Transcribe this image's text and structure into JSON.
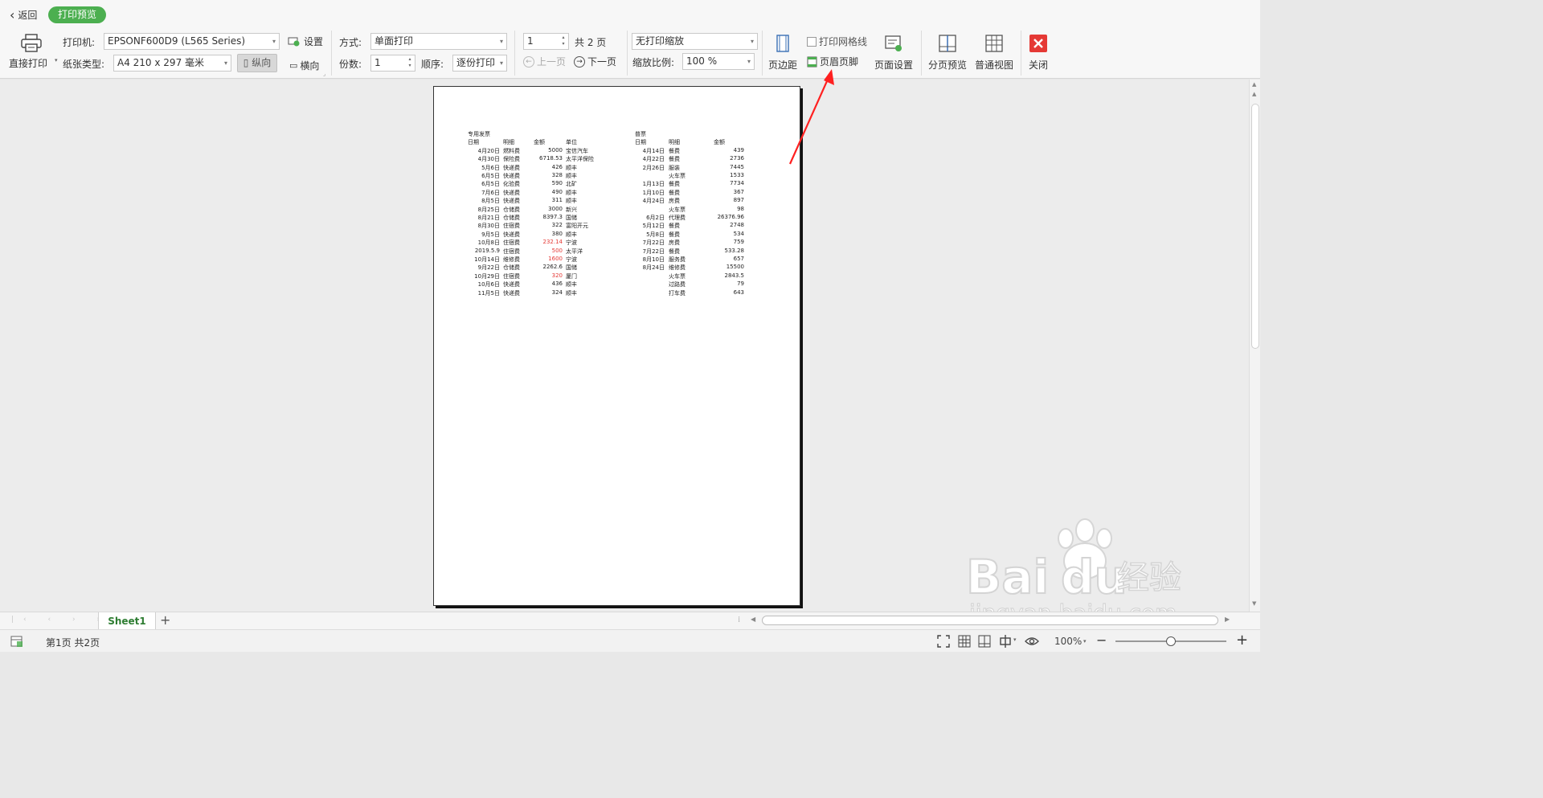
{
  "header": {
    "back_label": "返回",
    "mode_label": "打印预览"
  },
  "toolbar": {
    "direct_print": "直接打印",
    "printer_label": "打印机:",
    "printer_value": "EPSONF600D9 (L565 Series)",
    "settings_label": "设置",
    "paper_label": "纸张类型:",
    "paper_value": "A4 210 x 297 毫米",
    "portrait_label": "纵向",
    "landscape_label": "横向",
    "method_label": "方式:",
    "method_value": "单面打印",
    "copies_label": "份数:",
    "copies_value": "1",
    "order_label": "顺序:",
    "order_value": "逐份打印",
    "page_value": "1",
    "page_total": "共 2 页",
    "prev_page": "上一页",
    "next_page": "下一页",
    "scale_mode_value": "无打印缩放",
    "scale_label": "缩放比例:",
    "scale_value": "100 %",
    "margins_label": "页边距",
    "gridlines_label": "打印网格线",
    "header_footer_label": "页眉页脚",
    "page_setup_label": "页面设置",
    "page_break_preview_label": "分页预览",
    "normal_view_label": "普通视图",
    "close_label": "关闭"
  },
  "sheet": {
    "left_title": "专用发票",
    "left_headers": [
      "日期",
      "明细",
      "金额",
      "单位"
    ],
    "left_rows": [
      [
        "4月20日",
        "燃料费",
        "5000",
        "宝信汽车"
      ],
      [
        "4月30日",
        "保险费",
        "6718.53",
        "太平洋保险"
      ],
      [
        "5月6日",
        "快递费",
        "426",
        "顺丰"
      ],
      [
        "6月5日",
        "快递费",
        "328",
        "顺丰"
      ],
      [
        "6月5日",
        "化验费",
        "590",
        "北矿"
      ],
      [
        "7月6日",
        "快递费",
        "490",
        "顺丰"
      ],
      [
        "8月5日",
        "快递费",
        "311",
        "顺丰"
      ],
      [
        "8月25日",
        "仓储费",
        "3000",
        "新兴"
      ],
      [
        "8月21日",
        "仓储费",
        "8397.3",
        "国储"
      ],
      [
        "8月30日",
        "住宿费",
        "322",
        "富阳开元"
      ],
      [
        "9月5日",
        "快递费",
        "380",
        "顺丰"
      ],
      [
        "10月8日",
        "住宿费",
        "232.14",
        "宁波"
      ],
      [
        "2019.5.9",
        "住宿费",
        "500",
        "太平洋"
      ],
      [
        "10月14日",
        "维修费",
        "1600",
        "宁波"
      ],
      [
        "9月22日",
        "仓储费",
        "2262.6",
        "国储"
      ],
      [
        "10月29日",
        "住宿费",
        "320",
        "厦门"
      ],
      [
        "10月6日",
        "快递费",
        "436",
        "顺丰"
      ],
      [
        "11月5日",
        "快递费",
        "324",
        "顺丰"
      ]
    ],
    "left_red_rows": [
      11,
      12,
      13,
      15
    ],
    "right_title": "普票",
    "right_headers": [
      "日期",
      "明细",
      "金额"
    ],
    "right_rows": [
      [
        "4月14日",
        "餐费",
        "439"
      ],
      [
        "4月22日",
        "餐费",
        "2736"
      ],
      [
        "2月26日",
        "服装",
        "7445"
      ],
      [
        "",
        "火车票",
        "1533"
      ],
      [
        "1月13日",
        "餐费",
        "7734"
      ],
      [
        "1月10日",
        "餐费",
        "367"
      ],
      [
        "4月24日",
        "房费",
        "897"
      ],
      [
        "",
        "火车票",
        "98"
      ],
      [
        "6月2日",
        "代理费",
        "26376.96"
      ],
      [
        "5月12日",
        "餐费",
        "2748"
      ],
      [
        "5月8日",
        "餐费",
        "534"
      ],
      [
        "7月22日",
        "房费",
        "759"
      ],
      [
        "7月22日",
        "餐费",
        "533.28"
      ],
      [
        "8月10日",
        "服务费",
        "657"
      ],
      [
        "8月24日",
        "维修费",
        "15500"
      ],
      [
        "",
        "火车票",
        "2843.5"
      ],
      [
        "",
        "过路费",
        "79"
      ],
      [
        "",
        "打车费",
        "643"
      ]
    ]
  },
  "tabs": {
    "sheet_tab": "Sheet1",
    "add_tab": "+"
  },
  "status": {
    "page_info": "第1页 共2页",
    "zoom": "100%",
    "zoom_minus": "−",
    "zoom_plus": "+"
  },
  "watermark": {
    "brand": "Bai",
    "brand_tail": "du",
    "brand_cn": "经验",
    "url": "jingyan.baidu.com"
  },
  "colors": {
    "accent_green": "#4caf50",
    "close_red": "#e53935",
    "annotation_red": "#ff2020"
  }
}
